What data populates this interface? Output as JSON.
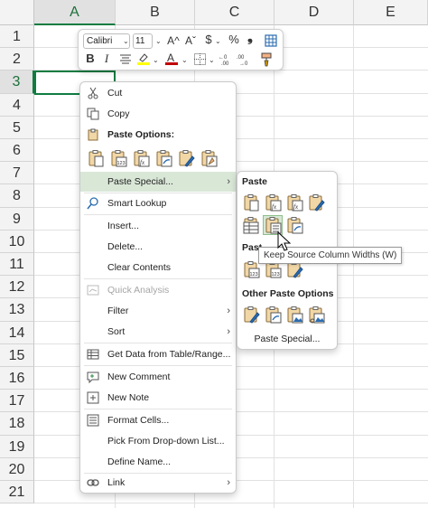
{
  "columns": [
    "A",
    "B",
    "C",
    "D",
    "E"
  ],
  "rows": [
    "1",
    "2",
    "3",
    "4",
    "5",
    "6",
    "7",
    "8",
    "9",
    "10",
    "11",
    "12",
    "13",
    "14",
    "15",
    "16",
    "17",
    "18",
    "19",
    "20",
    "21"
  ],
  "colors": {
    "accent": "#107c41",
    "highlight": "#d9e7d7",
    "font_color_red": "#c00000",
    "highlight_yellow": "#ffff00"
  },
  "mini_toolbar": {
    "font": "Calibri",
    "size": "11",
    "grow_font": "A^",
    "shrink_font": "Aˇ",
    "currency": "$",
    "percent": "%",
    "comma": "❟",
    "bold": "B",
    "italic": "I"
  },
  "context_menu": {
    "cut": "Cut",
    "copy": "Copy",
    "paste_options": "Paste Options:",
    "paste_special": "Paste Special...",
    "smart_lookup": "Smart Lookup",
    "insert": "Insert...",
    "delete": "Delete...",
    "clear_contents": "Clear Contents",
    "quick_analysis": "Quick Analysis",
    "filter": "Filter",
    "sort": "Sort",
    "get_data": "Get Data from Table/Range...",
    "new_comment": "New Comment",
    "new_note": "New Note",
    "format_cells": "Format Cells...",
    "pick_dropdown": "Pick From Drop-down List...",
    "define_name": "Define Name...",
    "link": "Link"
  },
  "submenu": {
    "paste_header": "Paste",
    "paste_values_header": "Past",
    "other_header": "Other Paste Options",
    "paste_special": "Paste Special..."
  },
  "tooltip": "Keep Source Column Widths (W)"
}
